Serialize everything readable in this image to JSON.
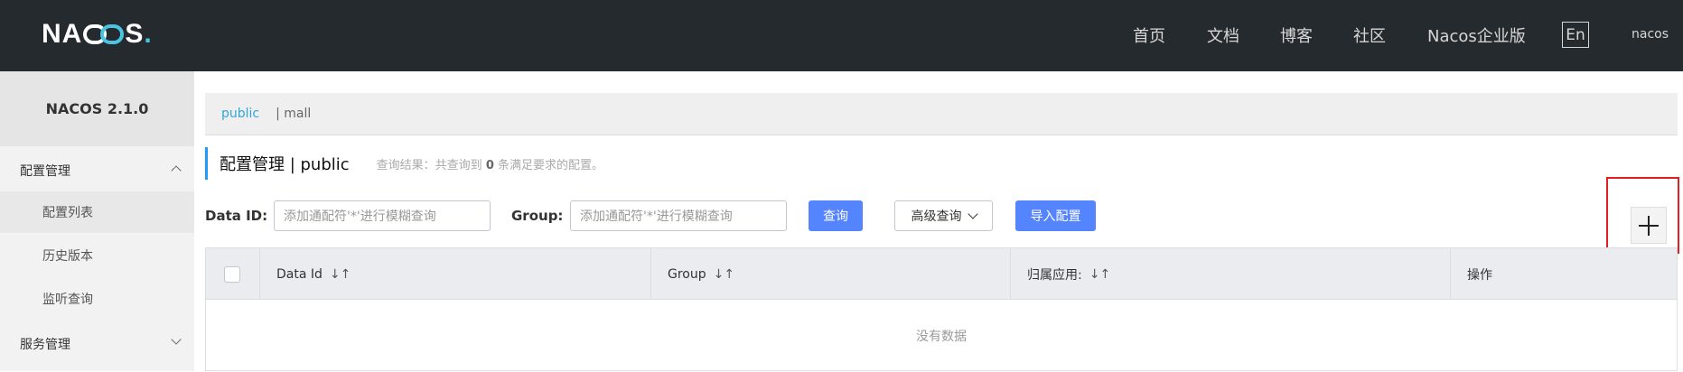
{
  "header": {
    "logo_text": "NACOS",
    "nav": [
      "首页",
      "文档",
      "博客",
      "社区",
      "Nacos企业版"
    ],
    "lang_button": "En",
    "user": "nacos"
  },
  "sidebar": {
    "version": "NACOS 2.1.0",
    "groups": [
      {
        "label": "配置管理",
        "expanded": true,
        "items": [
          "配置列表",
          "历史版本",
          "监听查询"
        ]
      },
      {
        "label": "服务管理",
        "expanded": false
      }
    ],
    "active_item": "配置列表"
  },
  "breadcrumb": {
    "namespace": "public",
    "separator_text": "| mall"
  },
  "page": {
    "title": "配置管理 | public",
    "result_prefix": "查询结果：共查询到",
    "result_count": "0",
    "result_suffix": "条满足要求的配置。"
  },
  "filters": {
    "dataid_label": "Data ID:",
    "dataid_placeholder": "添加通配符'*'进行模糊查询",
    "group_label": "Group:",
    "group_placeholder": "添加通配符'*'进行模糊查询",
    "search_button": "查询",
    "advanced_button": "高级查询",
    "import_button": "导入配置"
  },
  "table": {
    "columns": [
      {
        "label": "Data Id",
        "sortable": true
      },
      {
        "label": "Group",
        "sortable": true
      },
      {
        "label": "归属应用:",
        "sortable": true
      },
      {
        "label": "操作",
        "sortable": false
      }
    ],
    "empty_text": "没有数据",
    "sort_glyph": "↓↑"
  },
  "colors": {
    "accent": "#5584ff",
    "topbar": "#252a2f",
    "highlight": "#e02020",
    "link": "#2fa6d9"
  }
}
